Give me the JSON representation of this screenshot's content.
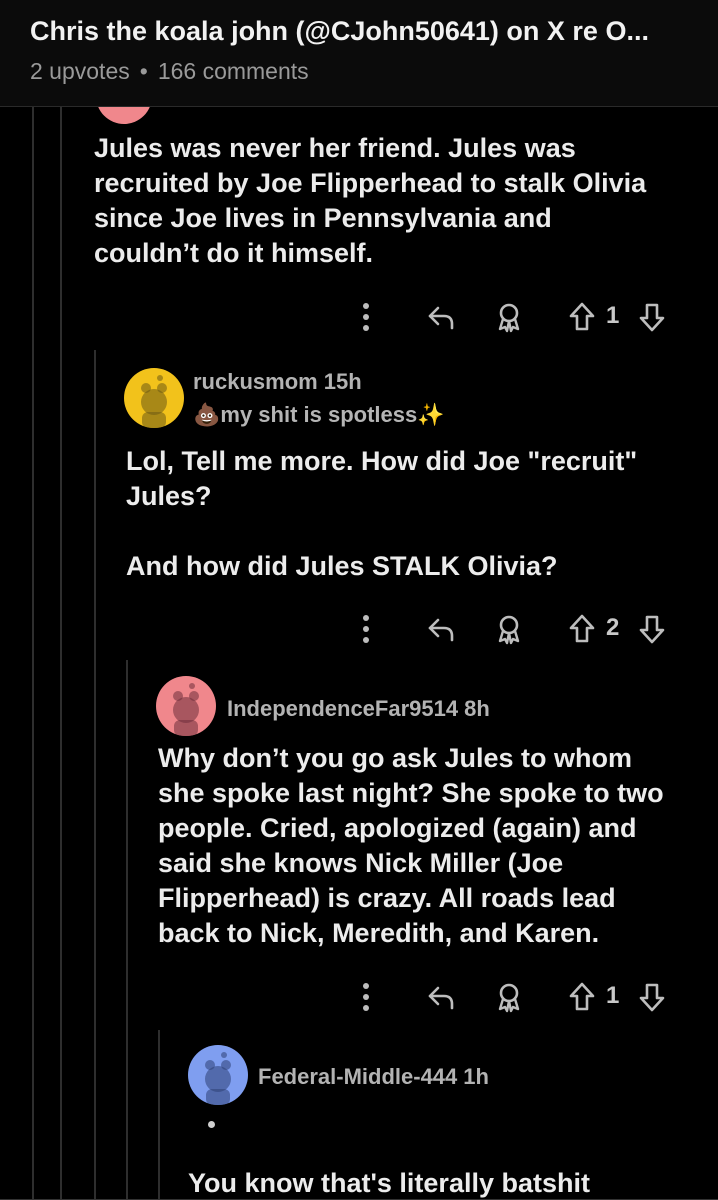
{
  "header": {
    "title": "Chris the koala john (@CJohn50641) on X re O...",
    "upvotes": "2 upvotes",
    "separator": "•",
    "comments": "166 comments"
  },
  "comments": [
    {
      "body": "Jules was never her friend. Jules was\nrecruited by Joe Flipperhead to stalk Olivia\nsince Joe lives in Pennsylvania and\ncouldn’t do it himself.",
      "score": "1"
    },
    {
      "username": "ruckusmom",
      "time": "15h",
      "flair": "💩my shit is spotless✨",
      "avatar_color": "#f2c21b",
      "body": "Lol, Tell me more. How did Joe \"recruit\"\nJules?\n\nAnd how did Jules STALK Olivia?",
      "score": "2"
    },
    {
      "username": "IndependenceFar9514",
      "time": "8h",
      "avatar_color": "#f0878c",
      "body": "Why don’t you go ask Jules to whom\nshe spoke last night? She spoke to two\npeople. Cried, apologized (again) and\nsaid she knows Nick Miller (Joe\nFlipperhead) is crazy. All roads lead\nback to Nick, Meredith, and Karen.",
      "score": "1"
    },
    {
      "username": "Federal-Middle-444",
      "time": "1h",
      "avatar_color": "#7f9ef0",
      "body": "You know that's literally batshit"
    }
  ],
  "colors": {
    "background": "#000000",
    "header_bg": "#0b0b0b",
    "thread_line": "#2e2e2e",
    "icon": "#bdbdbd"
  },
  "icons": {
    "more": "more-options-icon",
    "reply": "reply-icon",
    "award": "award-icon",
    "upvote": "upvote-arrow-icon",
    "downvote": "downvote-arrow-icon"
  }
}
